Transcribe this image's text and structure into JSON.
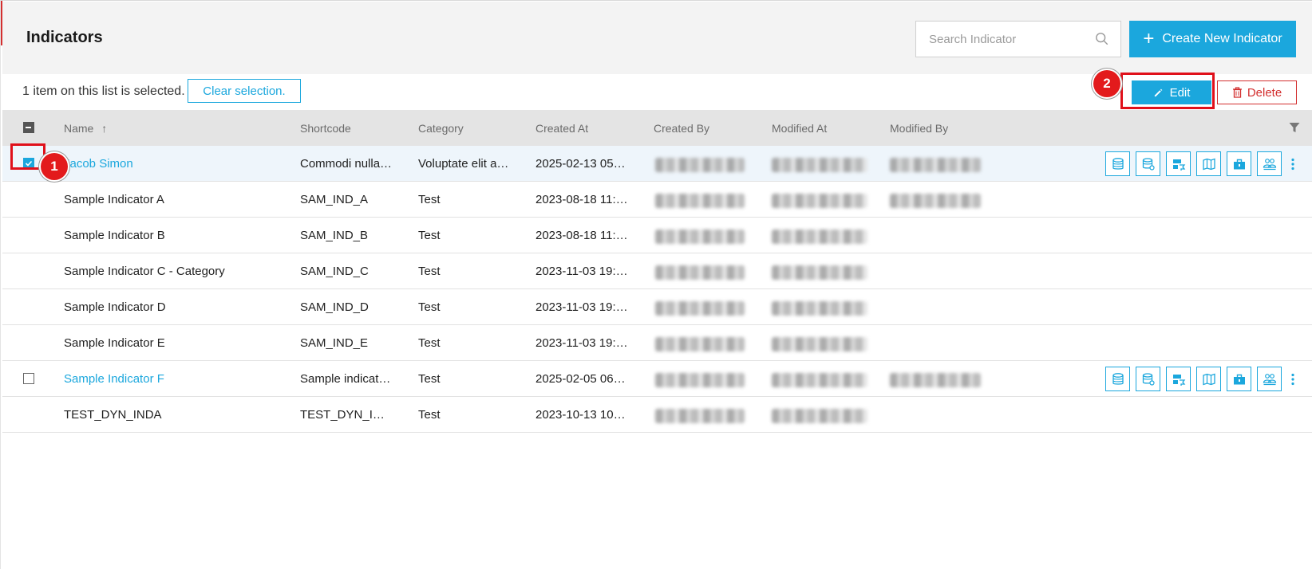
{
  "header": {
    "title": "Indicators",
    "search_placeholder": "Search Indicator",
    "create_label": "Create New Indicator"
  },
  "selection": {
    "text": "1 item on this list is selected.",
    "clear_label": "Clear selection.",
    "edit_label": "Edit",
    "delete_label": "Delete"
  },
  "annotations": [
    "1",
    "2"
  ],
  "columns": {
    "name": "Name",
    "sort_indicator": "↑",
    "shortcode": "Shortcode",
    "category": "Category",
    "created_at": "Created At",
    "created_by": "Created By",
    "modified_at": "Modified At",
    "modified_by": "Modified By"
  },
  "rows": [
    {
      "name": "Jacob Simon",
      "shortcode": "Commodi nulla…",
      "category": "Voluptate elit a…",
      "created_at": "2025-02-13 05…",
      "link": true,
      "checkbox": "checked",
      "actions": true,
      "modified_by_visible": true
    },
    {
      "name": "Sample Indicator A",
      "shortcode": "SAM_IND_A",
      "category": "Test",
      "created_at": "2023-08-18 11:…",
      "link": false,
      "checkbox": "none",
      "actions": false,
      "modified_by_visible": true
    },
    {
      "name": "Sample Indicator B",
      "shortcode": "SAM_IND_B",
      "category": "Test",
      "created_at": "2023-08-18 11:…",
      "link": false,
      "checkbox": "none",
      "actions": false,
      "modified_by_visible": false
    },
    {
      "name": "Sample Indicator C - Category",
      "shortcode": "SAM_IND_C",
      "category": "Test",
      "created_at": "2023-11-03 19:…",
      "link": false,
      "checkbox": "none",
      "actions": false,
      "modified_by_visible": false
    },
    {
      "name": "Sample Indicator D",
      "shortcode": "SAM_IND_D",
      "category": "Test",
      "created_at": "2023-11-03 19:…",
      "link": false,
      "checkbox": "none",
      "actions": false,
      "modified_by_visible": false
    },
    {
      "name": "Sample Indicator E",
      "shortcode": "SAM_IND_E",
      "category": "Test",
      "created_at": "2023-11-03 19:…",
      "link": false,
      "checkbox": "none",
      "actions": false,
      "modified_by_visible": false
    },
    {
      "name": "Sample Indicator F",
      "shortcode": "Sample indicat…",
      "category": "Test",
      "created_at": "2025-02-05 06…",
      "link": true,
      "checkbox": "empty",
      "actions": true,
      "modified_by_visible": true
    },
    {
      "name": "TEST_DYN_INDA",
      "shortcode": "TEST_DYN_I…",
      "category": "Test",
      "created_at": "2023-10-13 10…",
      "link": false,
      "checkbox": "none",
      "actions": false,
      "modified_by_visible": false
    }
  ],
  "row_action_icons": [
    "database-icon",
    "database-settings-icon",
    "layout-flag-icon",
    "map-icon",
    "briefcase-lock-icon",
    "group-users-icon"
  ],
  "colors": {
    "accent": "#1ba7dd",
    "danger": "#d32f2f",
    "annotation": "#e31a1c"
  }
}
